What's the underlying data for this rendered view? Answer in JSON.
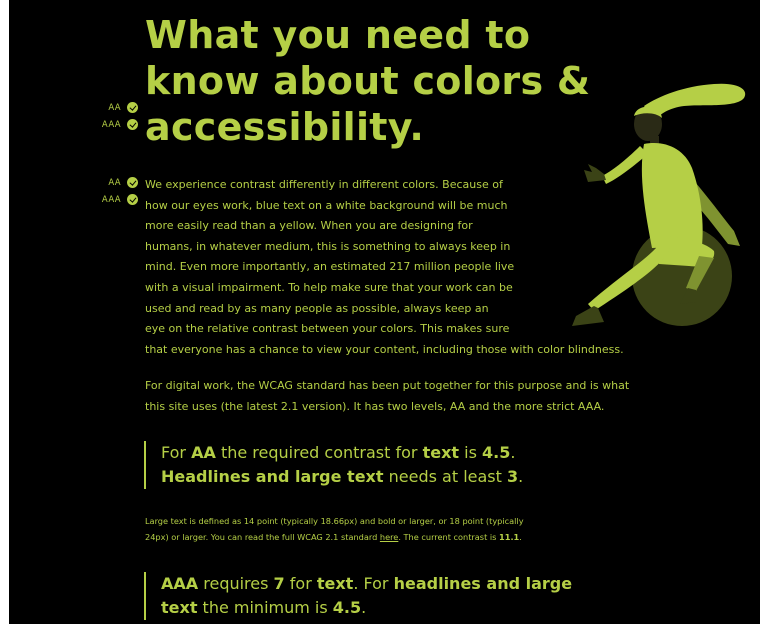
{
  "title": {
    "line1": "What you need to",
    "line2": "know about colors &",
    "line3": "accessibility."
  },
  "badges": {
    "aa": "AA",
    "aaa": "AAA"
  },
  "intro": {
    "lines": [
      "We experience contrast differently in different colors. Because of",
      "how our eyes work, blue text on a white background will be much",
      "more easily read than a yellow. When you are designing for",
      "humans, in whatever medium, this is something to always keep in",
      "mind. Even more importantly, an estimated 217 million people live",
      "with a visual impairment. To help make sure that your work can be",
      "used and read by as many people as possible, always keep an",
      "eye on the relative contrast between your colors. This makes sure",
      "that everyone has a chance to view your content, including those with color blindness."
    ]
  },
  "wcag": {
    "lines": [
      "For digital work, the WCAG standard has been put together for this purpose and is what",
      "this site uses (the latest 2.1 version). It has two levels, AA and the more strict AAA."
    ]
  },
  "quote_aa": {
    "t1": "For ",
    "b1": "AA",
    "t2": " the required contrast for ",
    "b2": "text",
    "t3": " is ",
    "b3": "4.5",
    "t4": ".",
    "b4": "Headlines and large text",
    "t5": " needs at least ",
    "b5": "3",
    "t6": "."
  },
  "large_text": {
    "line1": "Large text is defined as 14 point (typically 18.66px) and bold or larger, or 18 point (typically",
    "t1": "24px) or larger. You can read the full WCAG 2.1 standard ",
    "link": "here",
    "t2": ". The current contrast is ",
    "value": "11.1",
    "t3": "."
  },
  "quote_aaa": {
    "b1": "AAA",
    "t1": " requires ",
    "b2": "7",
    "t2": " for ",
    "b3": "text",
    "t3": ". For ",
    "b4": "headlines and large",
    "b5": "text",
    "t4": " the minimum is ",
    "b6": "4.5",
    "t5": "."
  },
  "colors": {
    "accent": "#b5cf46",
    "background": "#000000",
    "figure_dark": "#3b4316",
    "figure_mid": "#7f9330"
  },
  "icons": [
    "check-circle-icon",
    "person-on-ball-illustration"
  ]
}
